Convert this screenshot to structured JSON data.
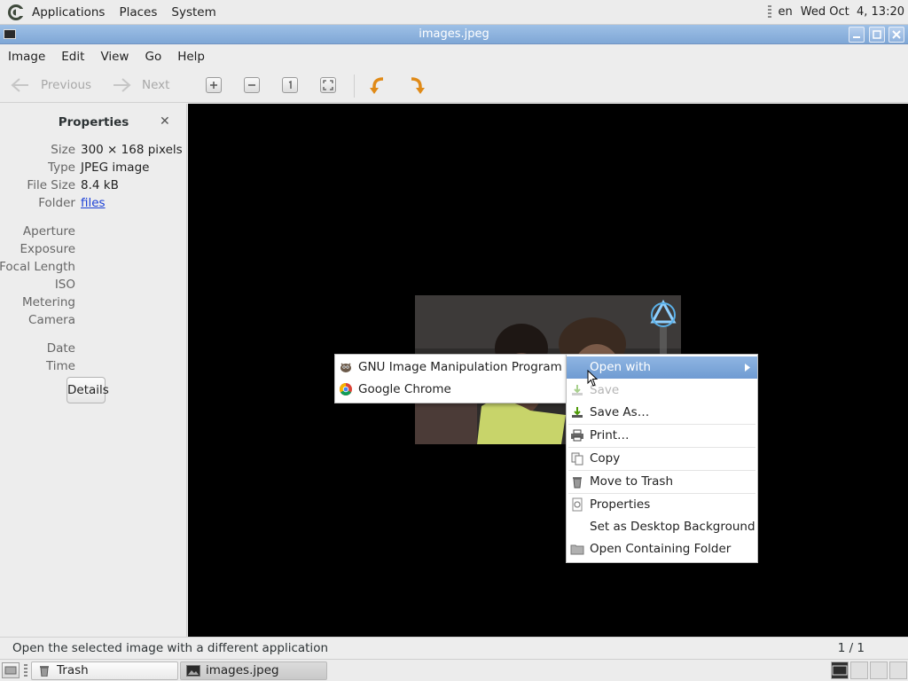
{
  "top_panel": {
    "menus": [
      "Applications",
      "Places",
      "System"
    ],
    "keyboard": "en",
    "clock": "Wed Oct  4, 13:20"
  },
  "window": {
    "title": "images.jpeg",
    "controls": [
      "minimize-icon",
      "maximize-icon",
      "close-icon"
    ]
  },
  "menubar": [
    "Image",
    "Edit",
    "View",
    "Go",
    "Help"
  ],
  "toolbar": {
    "previous": "Previous",
    "next": "Next",
    "buttons": [
      "zoom-in-icon",
      "zoom-out-icon",
      "normal-size-icon",
      "best-fit-icon",
      "rotate-left-icon",
      "rotate-right-icon"
    ]
  },
  "properties": {
    "title": "Properties",
    "rows": [
      {
        "key": "Size",
        "value": "300 × 168 pixels"
      },
      {
        "key": "Type",
        "value": "JPEG image"
      },
      {
        "key": "File Size",
        "value": "8.4 kB"
      },
      {
        "key": "Folder",
        "value": "files"
      }
    ],
    "exif": [
      {
        "key": "Aperture",
        "value": ""
      },
      {
        "key": "Exposure",
        "value": ""
      },
      {
        "key": "Focal Length",
        "value": ""
      },
      {
        "key": "ISO",
        "value": ""
      },
      {
        "key": "Metering",
        "value": ""
      },
      {
        "key": "Camera",
        "value": ""
      }
    ],
    "datetime": [
      {
        "key": "Date",
        "value": ""
      },
      {
        "key": "Time",
        "value": ""
      }
    ],
    "details_button": "Details"
  },
  "context_menu": {
    "items": [
      {
        "label": "Open with",
        "state": "selected",
        "icon": "",
        "submenu": true
      },
      {
        "label": "Save",
        "state": "disabled",
        "icon": "save-icon"
      },
      {
        "label": "Save As…",
        "state": "normal",
        "icon": "save-as-icon"
      },
      {
        "label": "Print…",
        "state": "normal",
        "icon": "print-icon"
      },
      {
        "label": "Copy",
        "state": "normal",
        "icon": "copy-icon"
      },
      {
        "label": "Move to Trash",
        "state": "normal",
        "icon": "trash-icon"
      },
      {
        "label": "Properties",
        "state": "normal",
        "icon": "properties-icon"
      },
      {
        "label": "Set as Desktop Background",
        "state": "normal",
        "icon": ""
      },
      {
        "label": "Open Containing Folder",
        "state": "normal",
        "icon": "folder-icon"
      }
    ]
  },
  "open_with_submenu": {
    "items": [
      {
        "label": "GNU Image Manipulation Program",
        "icon": "gimp-icon"
      },
      {
        "label": "Google Chrome",
        "icon": "chrome-icon"
      }
    ]
  },
  "statusbar": {
    "message": "Open the selected image with a different application",
    "count": "1 / 1"
  },
  "taskbar": {
    "tasks": [
      {
        "label": "Trash",
        "icon": "trash-icon",
        "active": false
      },
      {
        "label": "images.jpeg",
        "icon": "image-viewer-icon",
        "active": true
      }
    ]
  }
}
